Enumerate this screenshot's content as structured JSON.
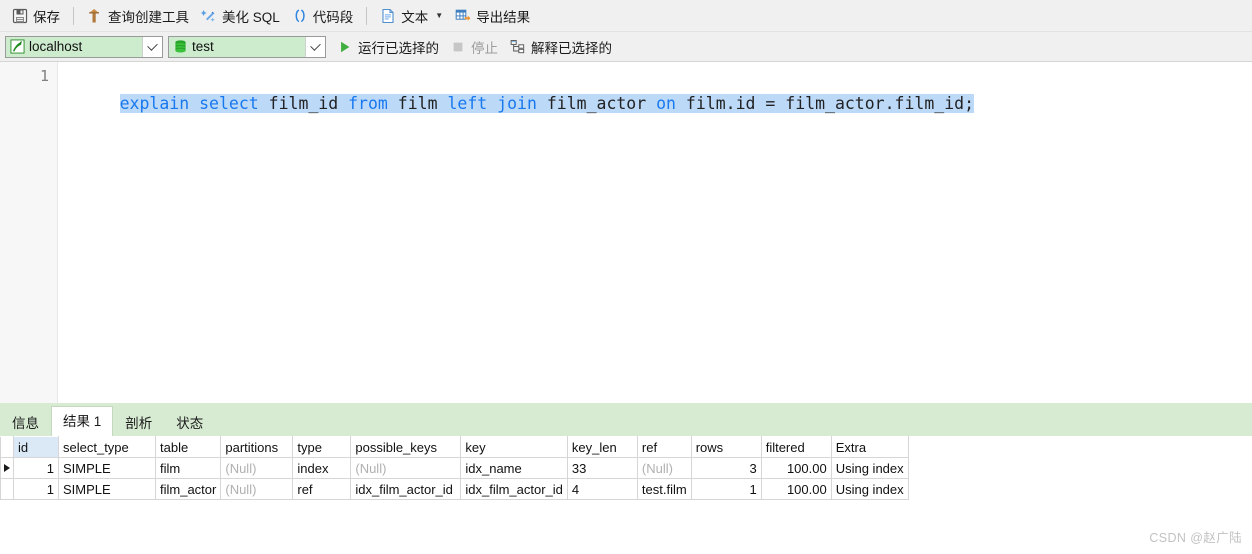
{
  "toolbar": {
    "items": [
      {
        "id": "save",
        "icon": "save-icon",
        "label": "保存"
      },
      {
        "id": "query-builder",
        "icon": "query-builder-icon",
        "label": "查询创建工具"
      },
      {
        "id": "beautify-sql",
        "icon": "magic-wand-icon",
        "label": "美化 SQL"
      },
      {
        "id": "snippet",
        "icon": "parentheses-icon",
        "label": "代码段"
      },
      {
        "id": "text",
        "icon": "document-icon",
        "label": "文本"
      },
      {
        "id": "export",
        "icon": "export-grid-icon",
        "label": "导出结果"
      }
    ]
  },
  "connbar": {
    "host": {
      "icon": "connection-icon",
      "value": "localhost"
    },
    "database": {
      "icon": "database-icon",
      "value": "test"
    },
    "run_selected": {
      "icon": "play-icon",
      "label": "运行已选择的"
    },
    "stop": {
      "icon": "stop-icon",
      "label": "停止"
    },
    "explain_selected": {
      "icon": "explain-icon",
      "label": "解释已选择的"
    }
  },
  "editor": {
    "line_number": "1",
    "sql": "explain select film_id from film left join film_actor on film.id = film_actor.film_id;",
    "tokens": [
      {
        "t": "explain",
        "kw": true
      },
      {
        "t": " ",
        "kw": false
      },
      {
        "t": "select",
        "kw": true
      },
      {
        "t": " film_id ",
        "kw": false
      },
      {
        "t": "from",
        "kw": true
      },
      {
        "t": " film ",
        "kw": false
      },
      {
        "t": "left",
        "kw": true
      },
      {
        "t": " ",
        "kw": false
      },
      {
        "t": "join",
        "kw": true
      },
      {
        "t": " film_actor ",
        "kw": false
      },
      {
        "t": "on",
        "kw": true
      },
      {
        "t": " film.id = film_actor.film_id;",
        "kw": false
      }
    ]
  },
  "result": {
    "tabs": [
      {
        "label": "信息",
        "active": false
      },
      {
        "label": "结果 1",
        "active": true
      },
      {
        "label": "剖析",
        "active": false
      },
      {
        "label": "状态",
        "active": false
      }
    ],
    "columns": [
      "id",
      "select_type",
      "table",
      "partitions",
      "type",
      "possible_keys",
      "key",
      "key_len",
      "ref",
      "rows",
      "filtered",
      "Extra"
    ],
    "rows": [
      {
        "selected": true,
        "cells": [
          "1",
          "SIMPLE",
          "film",
          "(Null)",
          "index",
          "(Null)",
          "idx_name",
          "33",
          "(Null)",
          "3",
          "100.00",
          "Using index"
        ]
      },
      {
        "selected": false,
        "cells": [
          "1",
          "SIMPLE",
          "film_actor",
          "(Null)",
          "ref",
          "idx_film_actor_id",
          "idx_film_actor_id",
          "4",
          "test.film",
          "1",
          "100.00",
          "Using index"
        ]
      }
    ]
  },
  "watermark": {
    "text": "CSDN @赵广陆"
  },
  "colors": {
    "toolbar_bg": "#f0f0f0",
    "combo_bg": "#cdebcd",
    "tabbar_bg": "#d7ead2",
    "selection_bg": "#bcd9f8",
    "keyword": "#1878f0",
    "null_text": "#b0b0b0",
    "run_green": "#3faf3f"
  }
}
